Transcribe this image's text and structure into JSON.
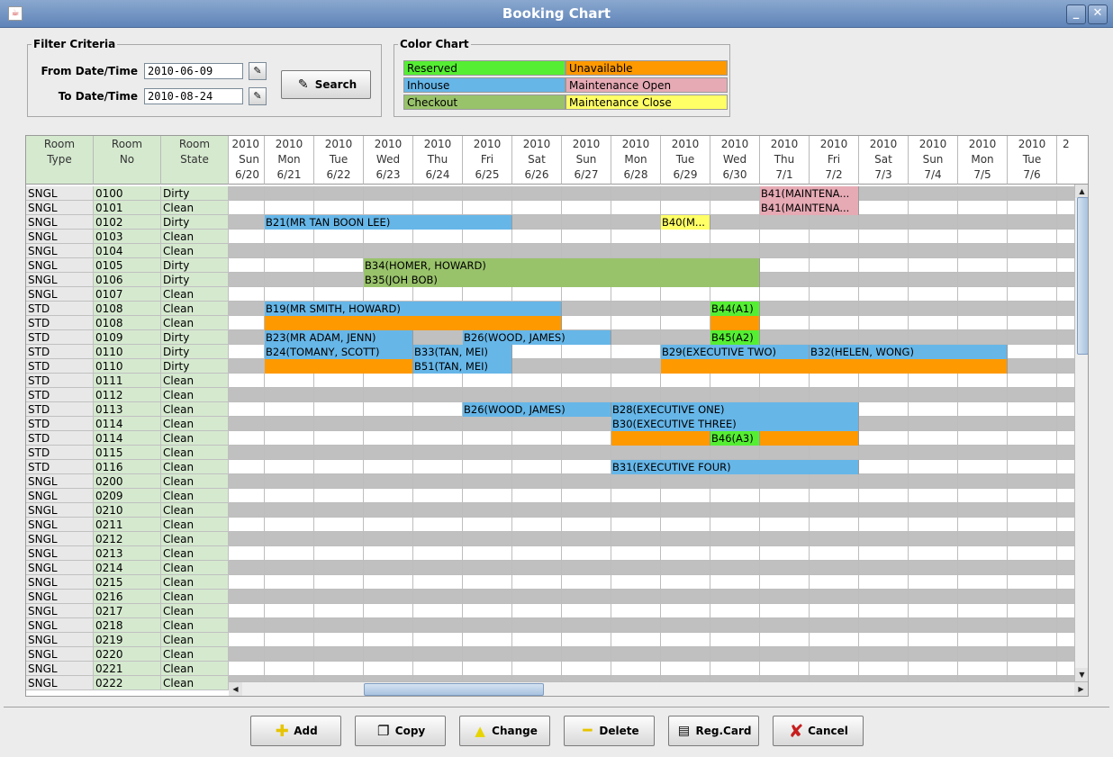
{
  "window": {
    "title": "Booking Chart",
    "minimize_glyph": "_",
    "close_glyph": "✕"
  },
  "filter": {
    "legend": "Filter Criteria",
    "from_label": "From Date/Time",
    "from_value": "2010-06-09",
    "to_label": "To Date/Time",
    "to_value": "2010-08-24",
    "search_label": "Search"
  },
  "color_chart": {
    "legend": "Color Chart",
    "items": [
      {
        "label": "Reserved",
        "color": "#55ee33"
      },
      {
        "label": "Unavailable",
        "color": "#ff9900"
      },
      {
        "label": "Inhouse",
        "color": "#66b6e8"
      },
      {
        "label": "Maintenance Open",
        "color": "#e6aab4"
      },
      {
        "label": "Checkout",
        "color": "#99c36b"
      },
      {
        "label": "Maintenance Close",
        "color": "#ffff66"
      }
    ]
  },
  "grid": {
    "headers": {
      "type": "Room\nType",
      "no": "Room\nNo",
      "state": "Room\nState"
    },
    "dates": [
      {
        "year": "2010",
        "dow": "Sun",
        "md": "6/20"
      },
      {
        "year": "2010",
        "dow": "Mon",
        "md": "6/21"
      },
      {
        "year": "2010",
        "dow": "Tue",
        "md": "6/22"
      },
      {
        "year": "2010",
        "dow": "Wed",
        "md": "6/23"
      },
      {
        "year": "2010",
        "dow": "Thu",
        "md": "6/24"
      },
      {
        "year": "2010",
        "dow": "Fri",
        "md": "6/25"
      },
      {
        "year": "2010",
        "dow": "Sat",
        "md": "6/26"
      },
      {
        "year": "2010",
        "dow": "Sun",
        "md": "6/27"
      },
      {
        "year": "2010",
        "dow": "Mon",
        "md": "6/28"
      },
      {
        "year": "2010",
        "dow": "Tue",
        "md": "6/29"
      },
      {
        "year": "2010",
        "dow": "Wed",
        "md": "6/30"
      },
      {
        "year": "2010",
        "dow": "Thu",
        "md": "7/1"
      },
      {
        "year": "2010",
        "dow": "Fri",
        "md": "7/2"
      },
      {
        "year": "2010",
        "dow": "Sat",
        "md": "7/3"
      },
      {
        "year": "2010",
        "dow": "Sun",
        "md": "7/4"
      },
      {
        "year": "2010",
        "dow": "Mon",
        "md": "7/5"
      },
      {
        "year": "2010",
        "dow": "Tue",
        "md": "7/6"
      },
      {
        "year": "2",
        "dow": "",
        "md": ""
      }
    ],
    "rows": [
      {
        "type": "SNGL",
        "no": "0100",
        "state": "Dirty"
      },
      {
        "type": "SNGL",
        "no": "0101",
        "state": "Clean"
      },
      {
        "type": "SNGL",
        "no": "0102",
        "state": "Dirty"
      },
      {
        "type": "SNGL",
        "no": "0103",
        "state": "Clean"
      },
      {
        "type": "SNGL",
        "no": "0104",
        "state": "Clean"
      },
      {
        "type": "SNGL",
        "no": "0105",
        "state": "Dirty"
      },
      {
        "type": "SNGL",
        "no": "0106",
        "state": "Dirty"
      },
      {
        "type": "SNGL",
        "no": "0107",
        "state": "Clean"
      },
      {
        "type": "STD",
        "no": "0108",
        "state": "Clean"
      },
      {
        "type": "STD",
        "no": "0108",
        "state": "Clean"
      },
      {
        "type": "STD",
        "no": "0109",
        "state": "Dirty"
      },
      {
        "type": "STD",
        "no": "0110",
        "state": "Dirty"
      },
      {
        "type": "STD",
        "no": "0110",
        "state": "Dirty"
      },
      {
        "type": "STD",
        "no": "0111",
        "state": "Clean"
      },
      {
        "type": "STD",
        "no": "0112",
        "state": "Clean"
      },
      {
        "type": "STD",
        "no": "0113",
        "state": "Clean"
      },
      {
        "type": "STD",
        "no": "0114",
        "state": "Clean"
      },
      {
        "type": "STD",
        "no": "0114",
        "state": "Clean"
      },
      {
        "type": "STD",
        "no": "0115",
        "state": "Clean"
      },
      {
        "type": "STD",
        "no": "0116",
        "state": "Clean"
      },
      {
        "type": "SNGL",
        "no": "0200",
        "state": "Clean"
      },
      {
        "type": "SNGL",
        "no": "0209",
        "state": "Clean"
      },
      {
        "type": "SNGL",
        "no": "0210",
        "state": "Clean"
      },
      {
        "type": "SNGL",
        "no": "0211",
        "state": "Clean"
      },
      {
        "type": "SNGL",
        "no": "0212",
        "state": "Clean"
      },
      {
        "type": "SNGL",
        "no": "0213",
        "state": "Clean"
      },
      {
        "type": "SNGL",
        "no": "0214",
        "state": "Clean"
      },
      {
        "type": "SNGL",
        "no": "0215",
        "state": "Clean"
      },
      {
        "type": "SNGL",
        "no": "0216",
        "state": "Clean"
      },
      {
        "type": "SNGL",
        "no": "0217",
        "state": "Clean"
      },
      {
        "type": "SNGL",
        "no": "0218",
        "state": "Clean"
      },
      {
        "type": "SNGL",
        "no": "0219",
        "state": "Clean"
      },
      {
        "type": "SNGL",
        "no": "0220",
        "state": "Clean"
      },
      {
        "type": "SNGL",
        "no": "0221",
        "state": "Clean"
      },
      {
        "type": "SNGL",
        "no": "0222",
        "state": "Clean"
      }
    ],
    "bookings": [
      {
        "row": 0,
        "start": 11,
        "end": 12,
        "label": "B41(MAINTENA...",
        "status": "Maintenance Open"
      },
      {
        "row": 1,
        "start": 11,
        "end": 12,
        "label": "B41(MAINTENA...",
        "status": "Maintenance Open"
      },
      {
        "row": 2,
        "start": 1,
        "end": 5,
        "label": "B21(MR TAN BOON LEE)",
        "status": "Inhouse"
      },
      {
        "row": 2,
        "start": 9,
        "end": 9,
        "label": "B40(M...",
        "status": "Maintenance Close"
      },
      {
        "row": 5,
        "start": 3,
        "end": 10,
        "label": "B34(HOMER, HOWARD)",
        "status": "Checkout"
      },
      {
        "row": 6,
        "start": 3,
        "end": 10,
        "label": "B35(JOH BOB)",
        "status": "Checkout"
      },
      {
        "row": 8,
        "start": 1,
        "end": 6,
        "label": "B19(MR SMITH, HOWARD)",
        "status": "Inhouse"
      },
      {
        "row": 8,
        "start": 10,
        "end": 10,
        "label": "B44(A1)",
        "status": "Reserved"
      },
      {
        "row": 9,
        "start": 1,
        "end": 6,
        "label": "",
        "status": "Unavailable"
      },
      {
        "row": 9,
        "start": 10,
        "end": 10,
        "label": "",
        "status": "Unavailable"
      },
      {
        "row": 10,
        "start": 1,
        "end": 3,
        "label": "B23(MR ADAM, JENN)",
        "status": "Inhouse"
      },
      {
        "row": 10,
        "start": 5,
        "end": 7,
        "label": "B26(WOOD, JAMES)",
        "status": "Inhouse"
      },
      {
        "row": 10,
        "start": 10,
        "end": 10,
        "label": "B45(A2)",
        "status": "Reserved"
      },
      {
        "row": 11,
        "start": 1,
        "end": 3,
        "label": "B24(TOMANY, SCOTT)",
        "status": "Inhouse"
      },
      {
        "row": 11,
        "start": 4,
        "end": 5,
        "label": "B33(TAN, MEI)",
        "status": "Inhouse"
      },
      {
        "row": 11,
        "start": 9,
        "end": 11,
        "label": "B29(EXECUTIVE TWO)",
        "status": "Inhouse"
      },
      {
        "row": 11,
        "start": 12,
        "end": 15,
        "label": "B32(HELEN, WONG)",
        "status": "Inhouse"
      },
      {
        "row": 12,
        "start": 1,
        "end": 3,
        "label": "",
        "status": "Unavailable"
      },
      {
        "row": 12,
        "start": 4,
        "end": 5,
        "label": "B51(TAN, MEI)",
        "status": "Inhouse"
      },
      {
        "row": 12,
        "start": 9,
        "end": 15,
        "label": "",
        "status": "Unavailable"
      },
      {
        "row": 15,
        "start": 5,
        "end": 7,
        "label": "B26(WOOD, JAMES)",
        "status": "Inhouse"
      },
      {
        "row": 15,
        "start": 8,
        "end": 12,
        "label": "B28(EXECUTIVE ONE)",
        "status": "Inhouse"
      },
      {
        "row": 16,
        "start": 8,
        "end": 12,
        "label": "B30(EXECUTIVE THREE)",
        "status": "Inhouse"
      },
      {
        "row": 17,
        "start": 8,
        "end": 9,
        "label": "",
        "status": "Unavailable"
      },
      {
        "row": 17,
        "start": 10,
        "end": 10,
        "label": "B46(A3)",
        "status": "Reserved"
      },
      {
        "row": 17,
        "start": 11,
        "end": 12,
        "label": "",
        "status": "Unavailable"
      },
      {
        "row": 19,
        "start": 8,
        "end": 12,
        "label": "B31(EXECUTIVE FOUR)",
        "status": "Inhouse"
      }
    ]
  },
  "scroll": {
    "up_glyph": "▲",
    "down_glyph": "▼",
    "left_glyph": "◀",
    "right_glyph": "▶"
  },
  "actions": [
    {
      "key": "add",
      "label": "Add",
      "icon": "add-icon"
    },
    {
      "key": "copy",
      "label": "Copy",
      "icon": "copy-icon"
    },
    {
      "key": "change",
      "label": "Change",
      "icon": "change-icon"
    },
    {
      "key": "delete",
      "label": "Delete",
      "icon": "delete-icon"
    },
    {
      "key": "regcard",
      "label": "Reg.Card",
      "icon": "regcard-icon"
    },
    {
      "key": "cancel",
      "label": "Cancel",
      "icon": "cancel-icon"
    }
  ]
}
